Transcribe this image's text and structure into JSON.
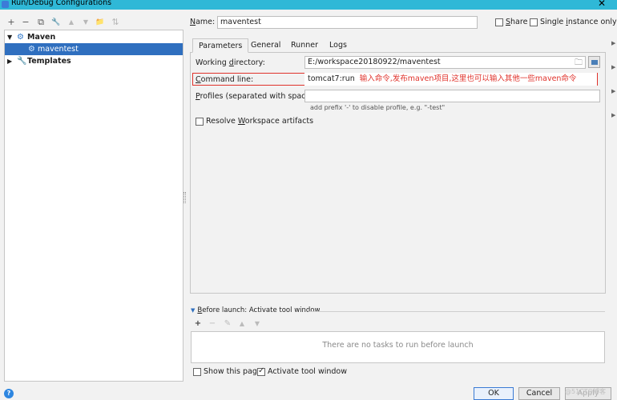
{
  "window": {
    "title": "Run/Debug Configurations",
    "close_glyph": "✕"
  },
  "toolbar": {
    "add": "+",
    "remove": "−",
    "copy": "⧉",
    "edit": "🔧",
    "move_up": "▲",
    "move_down": "▼",
    "folder": "📁",
    "sort": "⇅"
  },
  "tree": {
    "items": [
      {
        "label": "Maven",
        "expanded": true
      },
      {
        "label": "maventest",
        "selected": true
      },
      {
        "label": "Templates",
        "expanded": false
      }
    ]
  },
  "form": {
    "name_label_pre": "",
    "name_label_ul": "N",
    "name_label_post": "ame:",
    "name_value": "maventest",
    "share_pre": "",
    "share_ul": "S",
    "share_post": "hare",
    "single_pre": "Single ",
    "single_ul": "i",
    "single_post": "nstance only"
  },
  "tabs": [
    "Parameters",
    "General",
    "Runner",
    "Logs"
  ],
  "params": {
    "workdir_pre": "Working ",
    "workdir_ul": "d",
    "workdir_post": "irectory:",
    "workdir_value": "E:/workspace20180922/maventest",
    "cmd_pre": "",
    "cmd_ul": "C",
    "cmd_post": "ommand line:",
    "cmd_value": "tomcat7:run",
    "cmd_annotation": "输入命令,发布maven项目,这里也可以输入其他一些maven命令",
    "profiles_pre": "",
    "profiles_ul": "P",
    "profiles_post": "rofiles (separated with space):",
    "profiles_value": "",
    "profiles_hint": "add prefix '-' to disable profile, e.g. \"-test\"",
    "resolve_pre": "Resolve ",
    "resolve_ul": "W",
    "resolve_post": "orkspace artifacts",
    "resolve_checked": false
  },
  "before_launch": {
    "title_pre": "",
    "title_ul": "B",
    "title_post": "efore launch: Activate tool window",
    "toolbar": {
      "add": "+",
      "remove": "−",
      "edit": "✎",
      "up": "▲",
      "down": "▼"
    },
    "empty_message": "There are no tasks to run before launch",
    "show_page_label": "Show this page",
    "show_page_checked": false,
    "activate_label": "Activate tool window",
    "activate_checked": true
  },
  "buttons": {
    "ok": "OK",
    "cancel": "Cancel",
    "apply": "Apply"
  },
  "watermark": "@51CTO博客"
}
